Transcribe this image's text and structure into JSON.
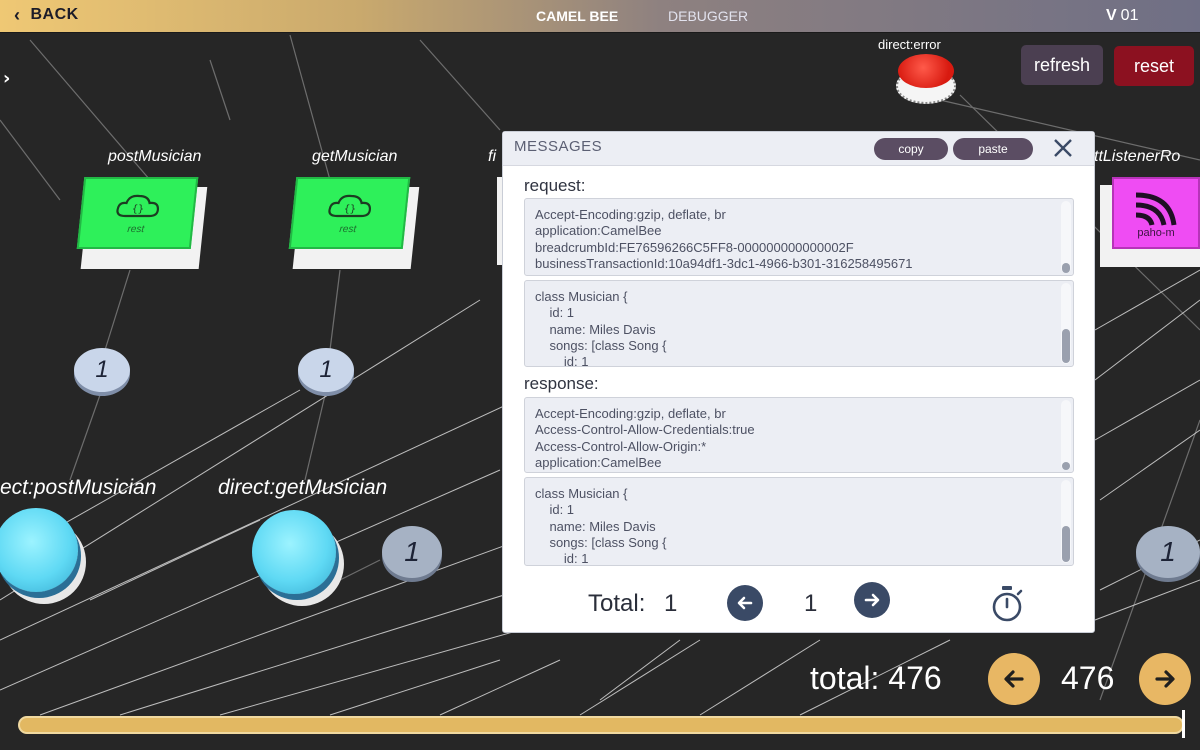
{
  "topbar": {
    "back_label": "BACK",
    "tab_active": "CAMEL BEE",
    "tab_inactive": "DEBUGGER",
    "version_prefix": "V",
    "version_number": "01"
  },
  "scene": {
    "nodes": {
      "post_musician": "postMusician",
      "get_musician": "getMusician",
      "partial_node": "fi",
      "mqtt_listener": "ttListenerRo",
      "direct_error": "direct:error",
      "direct_post": "ect:postMusician",
      "direct_get": "direct:getMusician",
      "card_rest_label": "rest",
      "pink_card_label": "paho-m"
    },
    "counters": {
      "post": "1",
      "get": "1",
      "route": "1",
      "right": "1"
    },
    "colors": {
      "rest_node": "#2ef05a",
      "mqtt_node": "#ef4cf3",
      "direct_node": "#5fd9f4",
      "error_node": "#d81a10"
    }
  },
  "buttons": {
    "refresh": "refresh",
    "reset": "reset"
  },
  "modal": {
    "title": "MESSAGES",
    "copy": "copy",
    "paste": "paste",
    "request_label": "request:",
    "request_headers": [
      "Accept-Encoding:gzip, deflate, br",
      "application:CamelBee",
      "breadcrumbId:FE76596266C5FF8-000000000000002F",
      "businessTransactionId:10a94df1-3dc1-4966-b301-316258495671"
    ],
    "request_body": [
      "class Musician {",
      "    id: 1",
      "    name: Miles Davis",
      "    songs: [class Song {",
      "        id: 1"
    ],
    "response_label": "response:",
    "response_headers": [
      "Accept-Encoding:gzip, deflate, br",
      "Access-Control-Allow-Credentials:true",
      "Access-Control-Allow-Origin:*",
      "application:CamelBee"
    ],
    "response_body": [
      "class Musician {",
      "    id: 1",
      "    name: Miles Davis",
      "    songs: [class Song {",
      "        id: 1"
    ],
    "total_label": "Total:",
    "total_value": "1",
    "page_value": "1"
  },
  "footer": {
    "total_text": "total: 476",
    "count": "476",
    "accent_color": "#e8b764"
  }
}
